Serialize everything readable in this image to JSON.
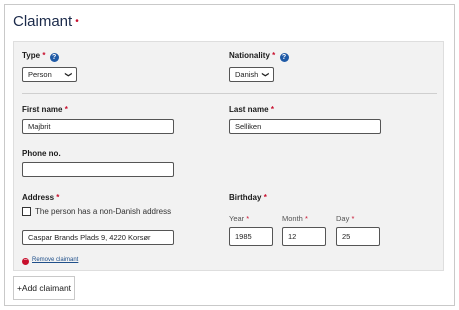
{
  "header": {
    "title": "Claimant",
    "required_mark": "•"
  },
  "form": {
    "type": {
      "label": "Type",
      "required": "*",
      "help": "?",
      "value": "Person"
    },
    "nationality": {
      "label": "Nationality",
      "required": "*",
      "help": "?",
      "value": "Danish"
    },
    "first_name": {
      "label": "First name",
      "required": "*",
      "value": "Majbrit"
    },
    "last_name": {
      "label": "Last name",
      "required": "*",
      "value": "Selliken"
    },
    "phone": {
      "label": "Phone no.",
      "value": ""
    },
    "address": {
      "label": "Address",
      "required": "*",
      "checkbox_label": "The person has a non-Danish address",
      "checkbox_checked": false,
      "value": "Caspar Brands Plads 9, 4220 Korsør"
    },
    "birthday": {
      "label": "Birthday",
      "required": "*",
      "year": {
        "label": "Year",
        "required": "*",
        "value": "1985"
      },
      "month": {
        "label": "Month",
        "required": "*",
        "value": "12"
      },
      "day": {
        "label": "Day",
        "required": "*",
        "value": "25"
      }
    },
    "remove_link": "Remove claimant"
  },
  "actions": {
    "add_claimant": "+Add claimant"
  },
  "colors": {
    "required": "#c8102e",
    "help_icon": "#1f5aa6",
    "panel_bg": "#f2f2f2",
    "link": "#1f4f8a"
  }
}
